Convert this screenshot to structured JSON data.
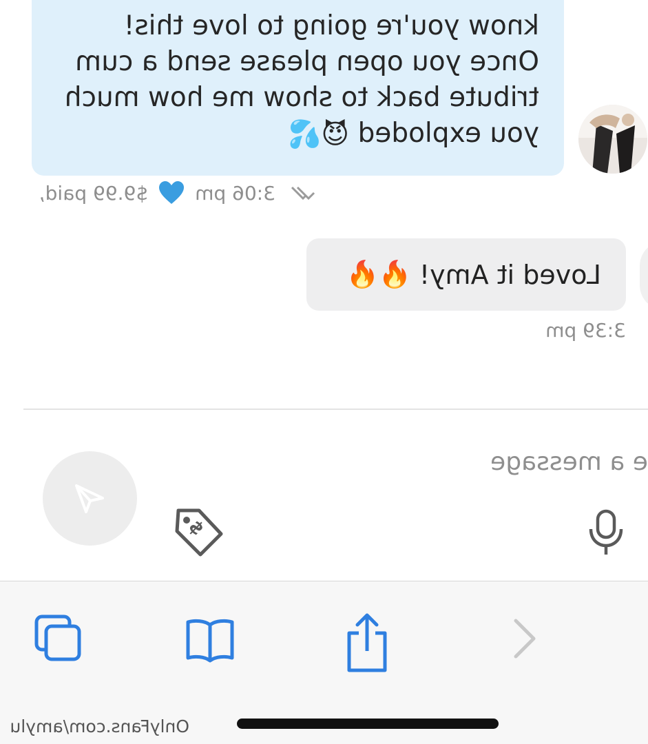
{
  "thread": {
    "incoming": {
      "lines": [
        "know you're going to love this!",
        "Once you open please send a cum",
        "tribute back to show me how much",
        "you exploded"
      ],
      "emojis": "😈💦",
      "price_paid": "$9.99 paid,",
      "time": "3:06 pm",
      "avatar": "avatar"
    },
    "outgoing": {
      "text": "Loved it Amy!",
      "emojis": "🔥🔥",
      "time": "3:39 pm"
    }
  },
  "composer": {
    "placeholder": "e a message",
    "mic": "microphone-icon",
    "tag": "price-tag-icon",
    "send": "send-icon"
  },
  "browser": {
    "url": "OnlyFans.com/amylu",
    "icons": [
      "back-chevron-icon",
      "share-icon",
      "bookmarks-icon",
      "tabs-icon"
    ]
  },
  "colors": {
    "incoming_bubble": "#dff0fb",
    "outgoing_bubble": "#eeeeef",
    "accent_blue": "#3a8ee6",
    "heart": "#3a9de0",
    "muted_text": "#8e8e8e"
  }
}
